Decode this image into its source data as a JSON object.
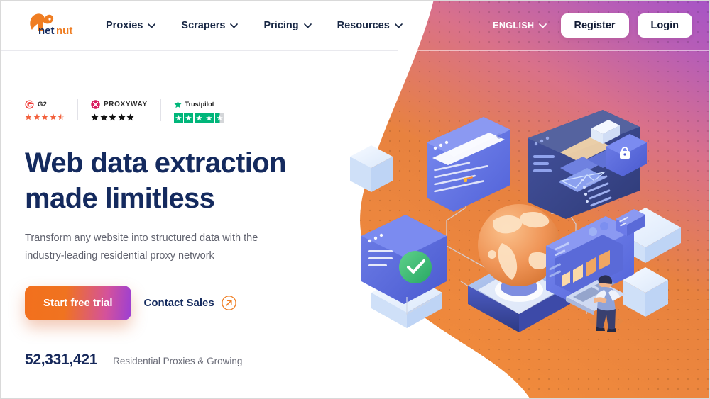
{
  "brand": {
    "name": "netnut",
    "name_part_1": "net",
    "name_part_2": "nut",
    "logo_icon": "squirrel-logo-icon",
    "orange": "#ef7d22",
    "navy": "#142a5e"
  },
  "header": {
    "nav": [
      {
        "label": "Proxies",
        "icon": "chevron-down-icon"
      },
      {
        "label": "Scrapers",
        "icon": "chevron-down-icon"
      },
      {
        "label": "Pricing",
        "icon": "chevron-down-icon"
      },
      {
        "label": "Resources",
        "icon": "chevron-down-icon"
      }
    ],
    "language": {
      "label": "ENGLISH",
      "icon": "chevron-down-icon"
    },
    "register_label": "Register",
    "login_label": "Login"
  },
  "hero": {
    "badges": [
      {
        "name": "G2",
        "logo_icon": "g2-logo-icon",
        "rating": 4.5,
        "star_style": "orange",
        "star_color": "#f2603c"
      },
      {
        "name": "PROXYWAY",
        "logo_icon": "proxyway-logo-icon",
        "rating": 5,
        "star_style": "black",
        "star_color": "#111111"
      },
      {
        "name": "Trustpilot",
        "logo_icon": "trustpilot-star-icon",
        "rating": 4.5,
        "star_style": "trustpilot-box",
        "star_color": "#00b67a"
      }
    ],
    "headline_line_1": "Web data extraction",
    "headline_line_2": "made limitless",
    "subhead_line_1": "Transform any website into structured data with the",
    "subhead_line_2": "industry-leading residential proxy network",
    "primary_cta": "Start free trial",
    "secondary_cta": "Contact Sales",
    "secondary_cta_icon": "arrow-up-right-circle-icon",
    "stat_number": "52,331,421",
    "stat_label": "Residential Proxies & Growing"
  },
  "illustration": {
    "name": "isometric-web-data-illustration",
    "elements": [
      "globe-on-pedestal",
      "browser-window-search",
      "browser-window-checkmark",
      "dashboard-panel",
      "chart-panel",
      "lock-badge",
      "person-at-keyboard",
      "floating-cubes"
    ]
  },
  "colors": {
    "blob_orange": "#f0883c",
    "gradient_pink": "#d46a8e",
    "gradient_purple": "#a855b8",
    "cta_gradient_start": "#f2701d",
    "cta_gradient_end": "#9b3fd4",
    "page_background": "#ffffff"
  }
}
